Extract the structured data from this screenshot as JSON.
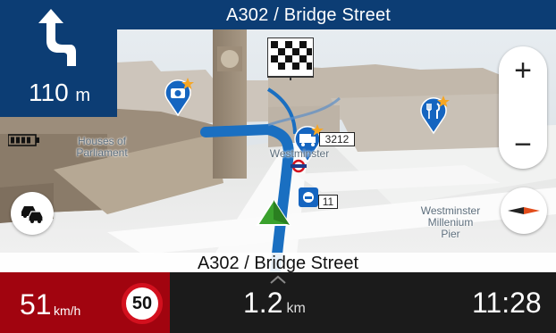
{
  "header": {
    "next_street": "A302 / Bridge Street"
  },
  "maneuver": {
    "distance_value": "110",
    "distance_unit": "m",
    "icon": "turn-left-arrow-icon"
  },
  "map": {
    "labels": {
      "houses_of_parliament": "Houses of\nParliament",
      "westminster_station": "Westminster",
      "pier": "Westminster\nMillenium\nPier",
      "road_number": "3212",
      "road_number_2": "11"
    },
    "pois": [
      "camera-poi-icon",
      "truck-poi-icon",
      "restaurant-poi-icon"
    ],
    "destination_icon": "checkered-flag-icon"
  },
  "controls": {
    "zoom_in": "+",
    "zoom_out": "−",
    "traffic_icon": "traffic-cars-icon",
    "compass_icon": "compass-icon"
  },
  "status": {
    "battery_icon": "battery-icon"
  },
  "current_street": "A302 / Bridge Street",
  "bottom": {
    "speed_value": "51",
    "speed_unit": "km/h",
    "speed_limit": "50",
    "remaining_distance": "1.2",
    "remaining_unit": "km",
    "eta": "11:28"
  },
  "colors": {
    "header_blue": "#0c3d74",
    "speed_red": "#a1040f",
    "route_blue": "#1a6fc1",
    "pin_blue": "#1565c0",
    "bottom_dark": "#1b1b1b"
  }
}
